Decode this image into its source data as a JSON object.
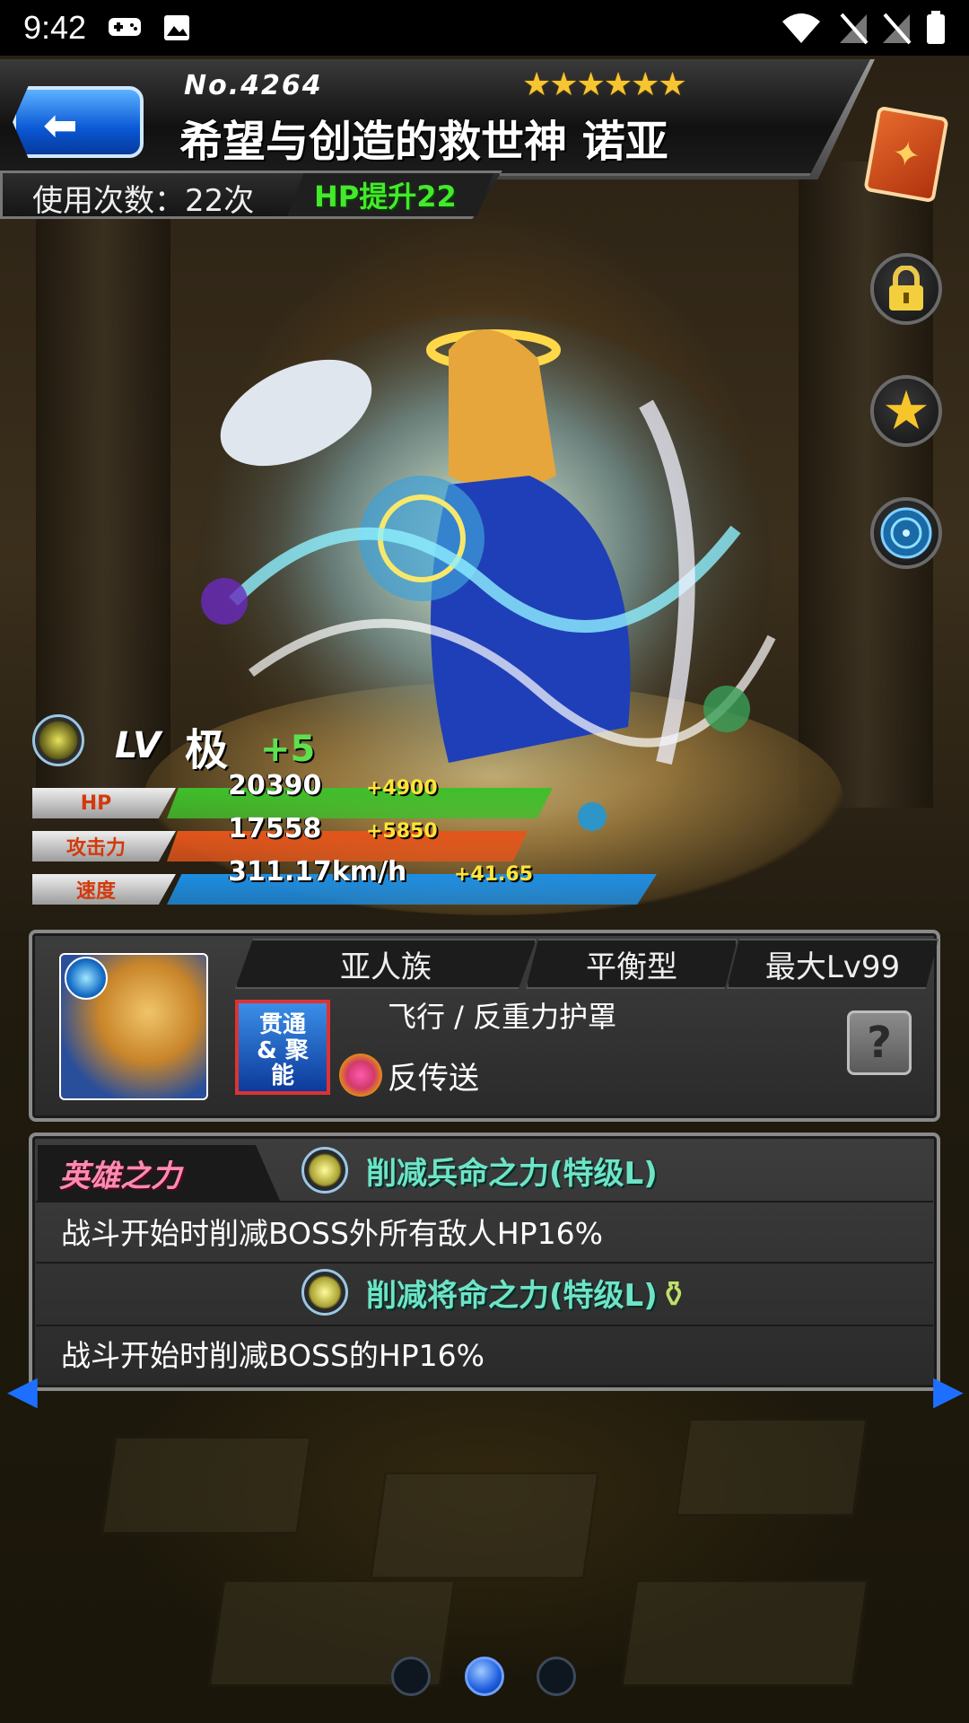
{
  "status_bar": {
    "time": "9:42"
  },
  "header": {
    "number": "No.4264",
    "rarity": "★★★★★★",
    "name": "希望与创造的救世神 诺亚",
    "use_count": "使用次数：22次",
    "hp_up": "HP提升22"
  },
  "level": {
    "label": "LV",
    "value": "极",
    "plus": "+5"
  },
  "stats": [
    {
      "label": "HP",
      "value": "20390",
      "bonus": "+4900",
      "color": "#3fbf2b"
    },
    {
      "label": "攻击力",
      "value": "17558",
      "bonus": "+5850",
      "color": "#e2551b"
    },
    {
      "label": "速度",
      "value": "311.17km/h",
      "bonus": "+41.65",
      "color": "#1e8ee2"
    }
  ],
  "info": {
    "race": "亚人族",
    "type": "平衡型",
    "max_level": "最大Lv99",
    "sling_type": "贯通 & 聚能",
    "abilities": "飞行 / 反重力护罩",
    "gang": "反传送",
    "help": "?"
  },
  "hero_power": {
    "label": "英雄之力",
    "skills": [
      {
        "name": "削减兵命之力(特级L)",
        "desc": "战斗开始时削减BOSS外所有敌人HP16%"
      },
      {
        "name": "削减将命之力(特级L)",
        "desc": "战斗开始时削减BOSS的HP16%"
      }
    ]
  },
  "pager": {
    "pages": 3,
    "active": 2
  }
}
